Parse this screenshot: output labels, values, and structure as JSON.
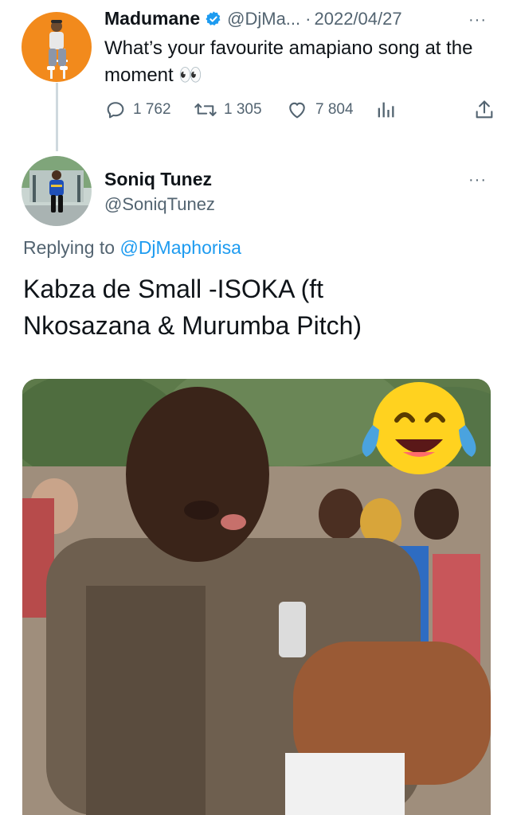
{
  "original_tweet": {
    "display_name": "Madumane",
    "handle": "@DjMa...",
    "separator": "·",
    "date": "2022/04/27",
    "text": "What’s your favourite amapiano song at the moment",
    "emoji": "👀",
    "stats": {
      "replies": "1 762",
      "retweets": "1 305",
      "likes": "7 804"
    },
    "icons": [
      "reply-icon",
      "retweet-icon",
      "like-icon",
      "analytics-icon",
      "share-icon"
    ]
  },
  "reply_tweet": {
    "display_name": "Soniq Tunez",
    "handle": "@SoniqTunez",
    "replying_prefix": "Replying to",
    "replying_to": "@DjMaphorisa",
    "text": "Kabza de Small -ISOKA (ft Nkosazana & Murumba Pitch)"
  },
  "more_glyph": "···",
  "colors": {
    "accent": "#1d9bf0",
    "muted": "#536471",
    "text": "#0f1419",
    "avatar_orange": "#f28a1c"
  }
}
